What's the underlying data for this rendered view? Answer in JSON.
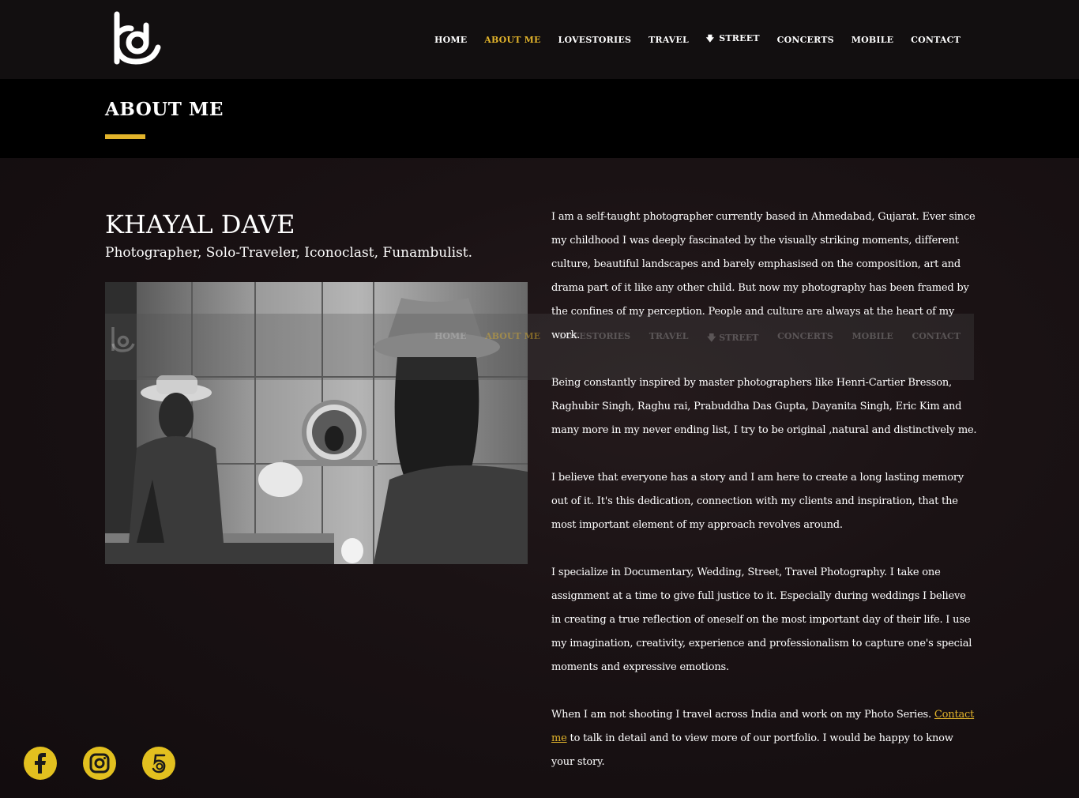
{
  "nav": {
    "items": [
      {
        "label": "HOME",
        "active": false
      },
      {
        "label": "ABOUT ME",
        "active": true
      },
      {
        "label": "LOVESTORIES",
        "active": false
      },
      {
        "label": "TRAVEL",
        "active": false
      },
      {
        "label": "STREET",
        "active": false,
        "icon": "arrow-down-icon"
      },
      {
        "label": "CONCERTS",
        "active": false
      },
      {
        "label": "MOBILE",
        "active": false
      },
      {
        "label": "CONTACT",
        "active": false
      }
    ]
  },
  "page": {
    "title": "ABOUT ME"
  },
  "profile": {
    "name": "KHAYAL DAVE",
    "tagline": "Photographer, Solo-Traveler, Iconoclast, Funambulist."
  },
  "bio": {
    "p1": "I am a self-taught photographer currently based in Ahmedabad, Gujarat. Ever since my childhood I was deeply fascinated by the visually striking moments, different culture, beautiful landscapes and barely emphasised on the composition, art and drama part of it like any other child. But now my photography has been framed by the confines of my perception. People and culture are always at the heart of my work.",
    "p2": "Being constantly inspired by master photographers like Henri-Cartier Bresson, Raghubir Singh, Raghu rai, Prabuddha Das Gupta, Dayanita Singh, Eric Kim and many more in my never ending list, I try to be original ,natural and distinctively me.",
    "p3": "I believe that everyone has a story and I am here to create a long lasting memory out of it. It's this dedication, connection with my clients and inspiration, that the most important element of my approach revolves around.",
    "p4": "I specialize in Documentary, Wedding, Street, Travel Photography. I take one assignment at a time to give full justice to it. Especially during weddings I believe in creating a true reflection of oneself on the most important day of their life. I use my imagination, creativity, experience and professionalism to capture one's special moments and expressive emotions.",
    "p5_before": "When I am not shooting I travel across India and work on my Photo Series. ",
    "p5_link": "Contact me",
    "p5_after": " to talk in detail and to view more of our portfolio. I would be happy to know your story."
  },
  "social": [
    {
      "name": "facebook-icon"
    },
    {
      "name": "instagram-icon"
    },
    {
      "name": "500px-icon"
    }
  ],
  "colors": {
    "accent": "#e2b42b",
    "header_bg": "#120f10",
    "titlebar_bg": "#000000",
    "social_bg": "#e2c01f"
  }
}
